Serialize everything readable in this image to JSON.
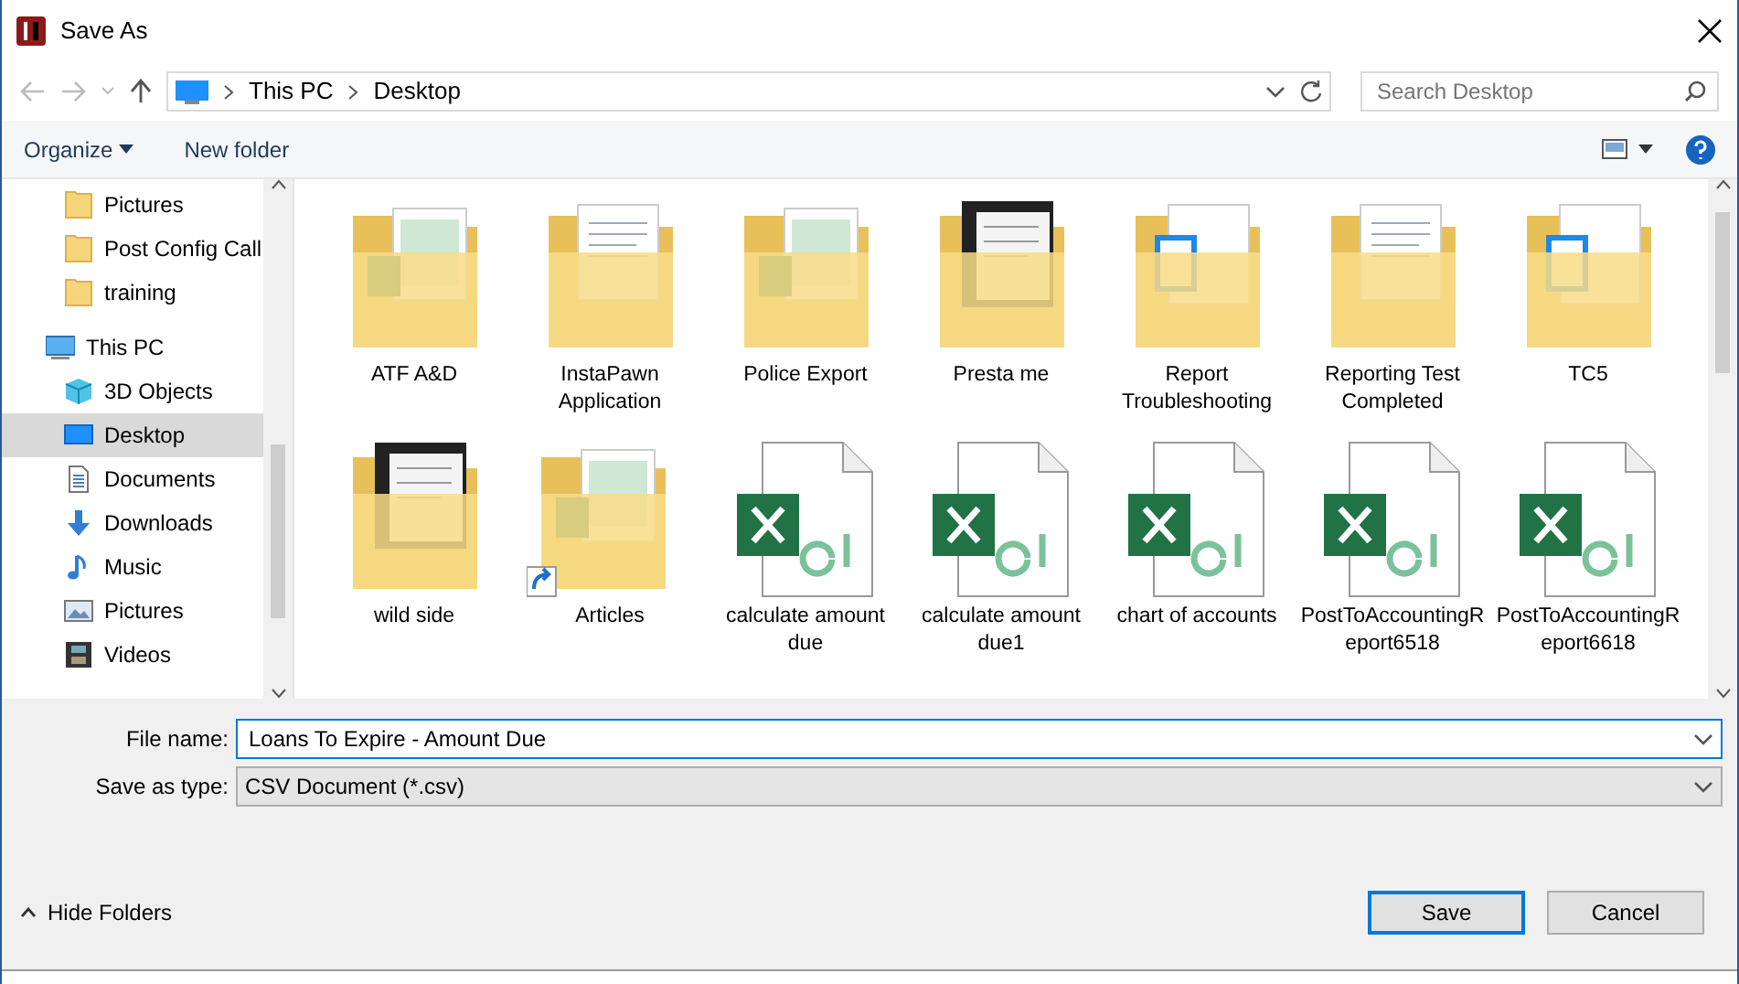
{
  "window": {
    "title": "Save As"
  },
  "address": {
    "crumbs": [
      "This PC",
      "Desktop"
    ]
  },
  "search": {
    "placeholder": "Search Desktop"
  },
  "toolbar": {
    "organize": "Organize",
    "new_folder": "New folder"
  },
  "sidebar": {
    "items": [
      {
        "label": "Pictures",
        "kind": "folder",
        "selected": false
      },
      {
        "label": "Post Config Call",
        "kind": "folder",
        "selected": false
      },
      {
        "label": "training",
        "kind": "folder",
        "selected": false
      },
      {
        "label": "This PC",
        "kind": "pc",
        "selected": false,
        "children": [
          {
            "label": "3D Objects",
            "kind": "cube",
            "selected": false
          },
          {
            "label": "Desktop",
            "kind": "desktop",
            "selected": true
          },
          {
            "label": "Documents",
            "kind": "document",
            "selected": false
          },
          {
            "label": "Downloads",
            "kind": "download",
            "selected": false
          },
          {
            "label": "Music",
            "kind": "music",
            "selected": false
          },
          {
            "label": "Pictures",
            "kind": "picture",
            "selected": false
          },
          {
            "label": "Videos",
            "kind": "video",
            "selected": false
          }
        ]
      }
    ]
  },
  "files": [
    {
      "name": "ATF A&D",
      "kind": "folder"
    },
    {
      "name": "InstaPawn Application",
      "kind": "folder"
    },
    {
      "name": "Police Export",
      "kind": "folder"
    },
    {
      "name": "Presta me",
      "kind": "folder"
    },
    {
      "name": "Report Troubleshooting",
      "kind": "folder"
    },
    {
      "name": "Reporting Test Completed",
      "kind": "folder"
    },
    {
      "name": "TC5",
      "kind": "folder"
    },
    {
      "name": "wild side",
      "kind": "folder"
    },
    {
      "name": "Articles",
      "kind": "shortcut"
    },
    {
      "name": "calculate amount due",
      "kind": "excel"
    },
    {
      "name": "calculate amount due1",
      "kind": "excel"
    },
    {
      "name": "chart of accounts",
      "kind": "excel"
    },
    {
      "name": "PostToAccountingReport6518",
      "kind": "excel"
    },
    {
      "name": "PostToAccountingReport6618",
      "kind": "excel"
    }
  ],
  "form": {
    "file_name_label": "File name:",
    "file_name": "Loans To Expire - Amount Due",
    "type_label": "Save as type:",
    "type": "CSV Document (*.csv)"
  },
  "footer": {
    "hide_folders": "Hide Folders",
    "save": "Save",
    "cancel": "Cancel"
  }
}
